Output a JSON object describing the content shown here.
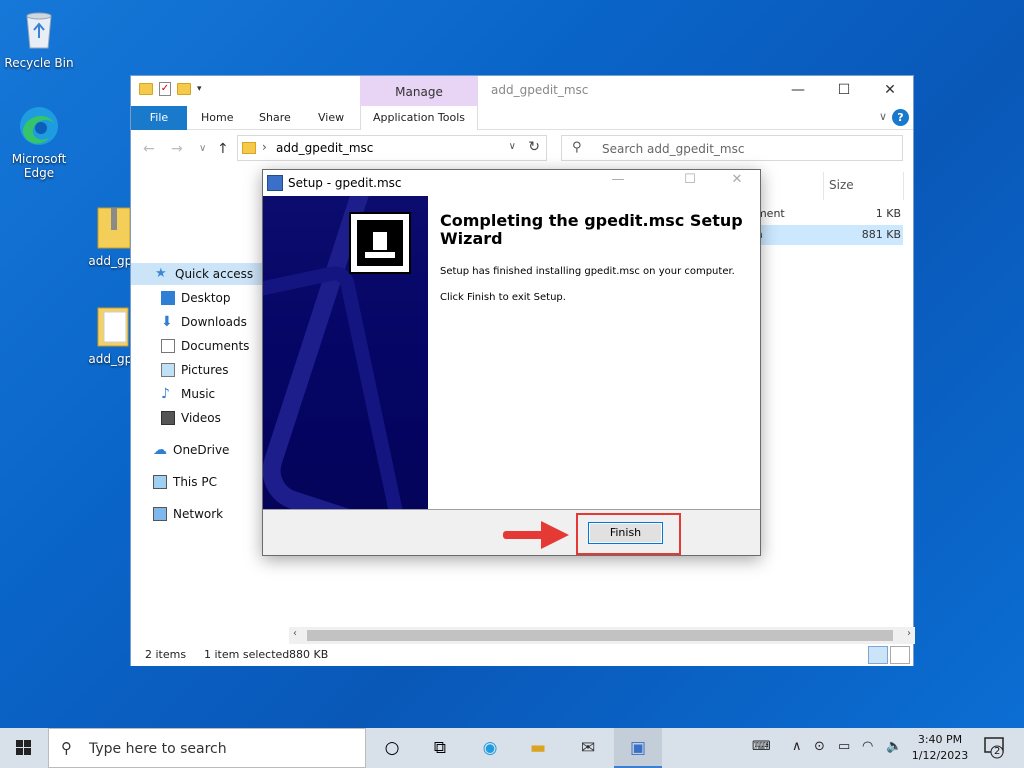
{
  "desktop": {
    "icons": [
      {
        "label": "Recycle Bin"
      },
      {
        "label": "Microsoft Edge"
      },
      {
        "label": "add_gpe"
      },
      {
        "label": "add_gpe"
      }
    ]
  },
  "explorer": {
    "title": "add_gpedit_msc",
    "context_tab": "Manage",
    "tabs": [
      "File",
      "Home",
      "Share",
      "View",
      "Application Tools"
    ],
    "address": "add_gpedit_msc",
    "search_placeholder": "Search add_gpedit_msc",
    "nav": {
      "quick_access": "Quick access",
      "desktop": "Desktop",
      "downloads": "Downloads",
      "documents": "Documents",
      "pictures": "Pictures",
      "music": "Music",
      "videos": "Videos",
      "onedrive": "OneDrive",
      "thispc": "This PC",
      "network": "Network"
    },
    "column_size": "Size",
    "rows": [
      {
        "type": "ument",
        "size": "1 KB"
      },
      {
        "type": "on",
        "size": "881 KB"
      }
    ],
    "status": {
      "items": "2 items",
      "selected": "1 item selected",
      "size": "880 KB"
    }
  },
  "dialog": {
    "title": "Setup - gpedit.msc",
    "heading": "Completing the gpedit.msc Setup Wizard",
    "line1": "Setup has finished installing gpedit.msc on your computer.",
    "line2": "Click Finish to exit Setup.",
    "finish_label": "Finish"
  },
  "taskbar": {
    "search_placeholder": "Type here to search",
    "time": "3:40 PM",
    "date": "1/12/2023",
    "notification_count": "2"
  },
  "colors": {
    "accent": "#1979ca",
    "highlight_red": "#e53935",
    "context_purple": "#e8d4f5"
  }
}
